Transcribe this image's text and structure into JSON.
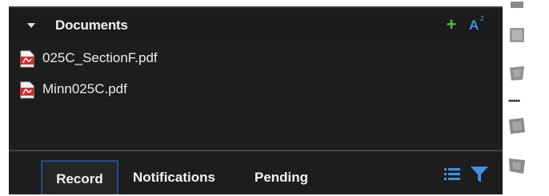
{
  "documents_panel": {
    "title": "Documents",
    "add_icon": "plus-icon",
    "sort_icon": "sort-alphabetical-icon",
    "sort_glyph_a": "A",
    "sort_glyph_z": "Z",
    "files": [
      {
        "name": "025C_SectionF.pdf",
        "icon": "pdf-file-icon"
      },
      {
        "name": "Minn025C.pdf",
        "icon": "pdf-file-icon"
      }
    ]
  },
  "tabs": {
    "record": "Record",
    "notifications": "Notifications",
    "pending": "Pending",
    "active": "Record"
  },
  "tab_tools": {
    "list_icon": "list-view-icon",
    "filter_icon": "filter-icon"
  },
  "colors": {
    "panel_bg": "#1d1d1d",
    "text": "#f2f2f2",
    "add_green": "#4fbf34",
    "accent_blue": "#3f8fe3",
    "pdf_red": "#d62a2a",
    "active_tab_border": "#1a4f88"
  }
}
